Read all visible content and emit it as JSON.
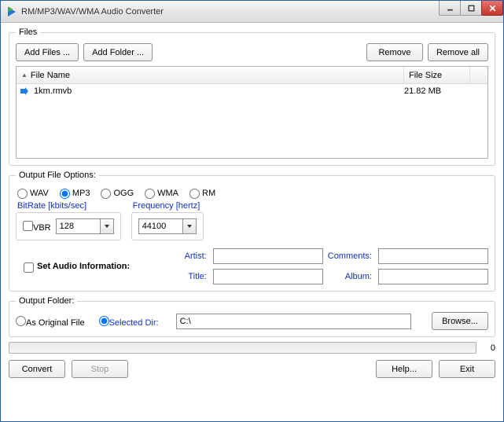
{
  "window": {
    "title": "RM/MP3/WAV/WMA Audio Converter"
  },
  "files_group": {
    "legend": "Files",
    "add_files": "Add Files ...",
    "add_folder": "Add Folder ...",
    "remove": "Remove",
    "remove_all": "Remove all",
    "col_name": "File Name",
    "col_size": "File Size",
    "rows": [
      {
        "icon": "arrow-right",
        "name": "1km.rmvb",
        "size": "21.82 MB"
      }
    ]
  },
  "output_options": {
    "legend": "Output File Options:",
    "formats": {
      "wav": "WAV",
      "mp3": "MP3",
      "ogg": "OGG",
      "wma": "WMA",
      "rm": "RM",
      "selected": "mp3"
    },
    "bitrate": {
      "legend": "BitRate [kbits/sec]",
      "vbr_label": "VBR",
      "vbr_checked": false,
      "value": "128"
    },
    "frequency": {
      "legend": "Frequency [hertz]",
      "value": "44100"
    },
    "set_audio_info": {
      "label": "Set Audio Information:",
      "checked": false
    },
    "meta": {
      "artist_label": "Artist:",
      "title_label": "Title:",
      "comments_label": "Comments:",
      "album_label": "Album:",
      "artist": "",
      "title": "",
      "comments": "",
      "album": ""
    }
  },
  "output_folder": {
    "legend": "Output Folder:",
    "as_original": "As Original File",
    "selected_dir_label": "Selected Dir:",
    "selected": "selected_dir",
    "dir_value": "C:\\",
    "browse": "Browse..."
  },
  "progress": {
    "value": 0,
    "label": "0"
  },
  "bottom": {
    "convert": "Convert",
    "stop": "Stop",
    "help": "Help...",
    "exit": "Exit"
  }
}
